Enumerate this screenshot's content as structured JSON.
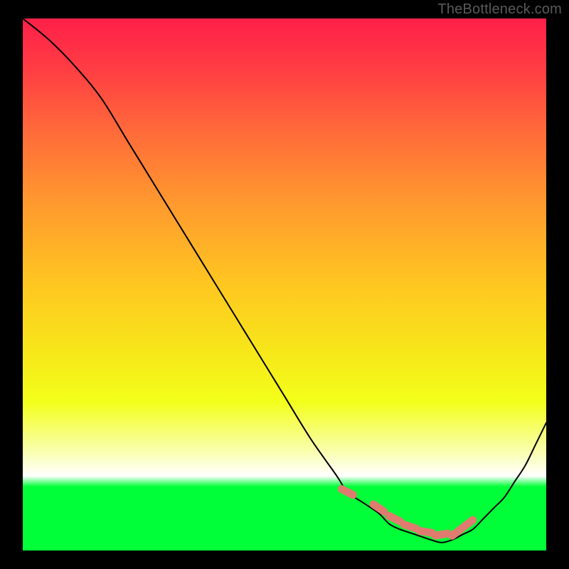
{
  "watermark": "TheBottleneck.com",
  "colors": {
    "background": "#000000",
    "gradient_top": "#ff1f49",
    "gradient_bottom": "#00ff38",
    "curve": "#000000",
    "points": "#e07b6f"
  },
  "chart_data": {
    "type": "line",
    "title": "",
    "xlabel": "",
    "ylabel": "",
    "xlim": [
      0,
      100
    ],
    "ylim": [
      0,
      100
    ],
    "series": [
      {
        "name": "bottleneck-curve",
        "x": [
          0,
          5,
          10,
          15,
          20,
          25,
          30,
          35,
          40,
          45,
          50,
          55,
          60,
          62,
          65,
          68,
          70,
          72,
          75,
          78,
          80,
          82,
          84,
          86,
          88,
          90,
          92,
          94,
          96,
          98,
          100
        ],
        "values": [
          100,
          96,
          91,
          85,
          77,
          69,
          61,
          53,
          45,
          37,
          29,
          21,
          14,
          11,
          9,
          7,
          5,
          4,
          3,
          2,
          1.5,
          2,
          3,
          4,
          6,
          8,
          10,
          13,
          16,
          20,
          24
        ]
      }
    ],
    "highlight_points": {
      "name": "optimal-range",
      "x": [
        62,
        68,
        71,
        74,
        77,
        80,
        83,
        85
      ],
      "values": [
        11,
        8,
        6,
        4.5,
        3.5,
        3,
        3.5,
        5
      ]
    }
  }
}
